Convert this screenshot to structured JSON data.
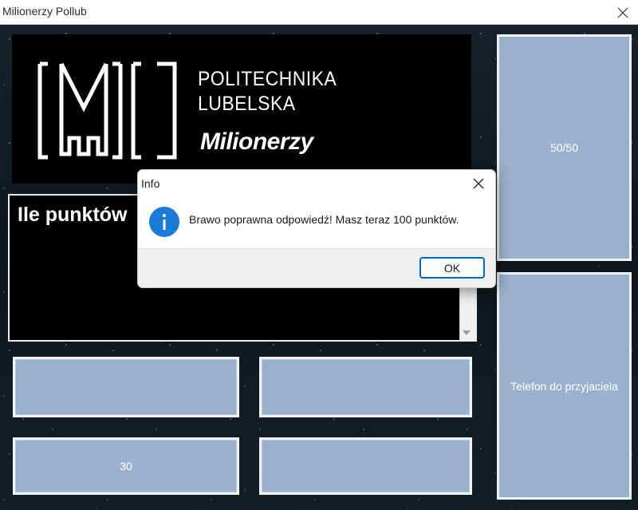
{
  "window": {
    "title": "Milionerzy Pollub"
  },
  "logo": {
    "line1": "POLITECHNIKA",
    "line2": "LUBELSKA",
    "tagline": "Milionerzy"
  },
  "question": {
    "text": "Ile punktów"
  },
  "answers": [
    {
      "label": ""
    },
    {
      "label": ""
    },
    {
      "label": "30"
    },
    {
      "label": ""
    }
  ],
  "lifelines": {
    "fifty_fifty": "50/50",
    "phone_friend": "Telefon do przyjaciela"
  },
  "dialog": {
    "title": "Info",
    "message": "Brawo poprawna odpowiedź! Masz teraz 100 punktów.",
    "ok_label": "OK",
    "icon": "info-icon"
  },
  "colors": {
    "answer_fill": "#99b1cd",
    "info_blue": "#1b79d8",
    "ok_border": "#0067c0"
  }
}
